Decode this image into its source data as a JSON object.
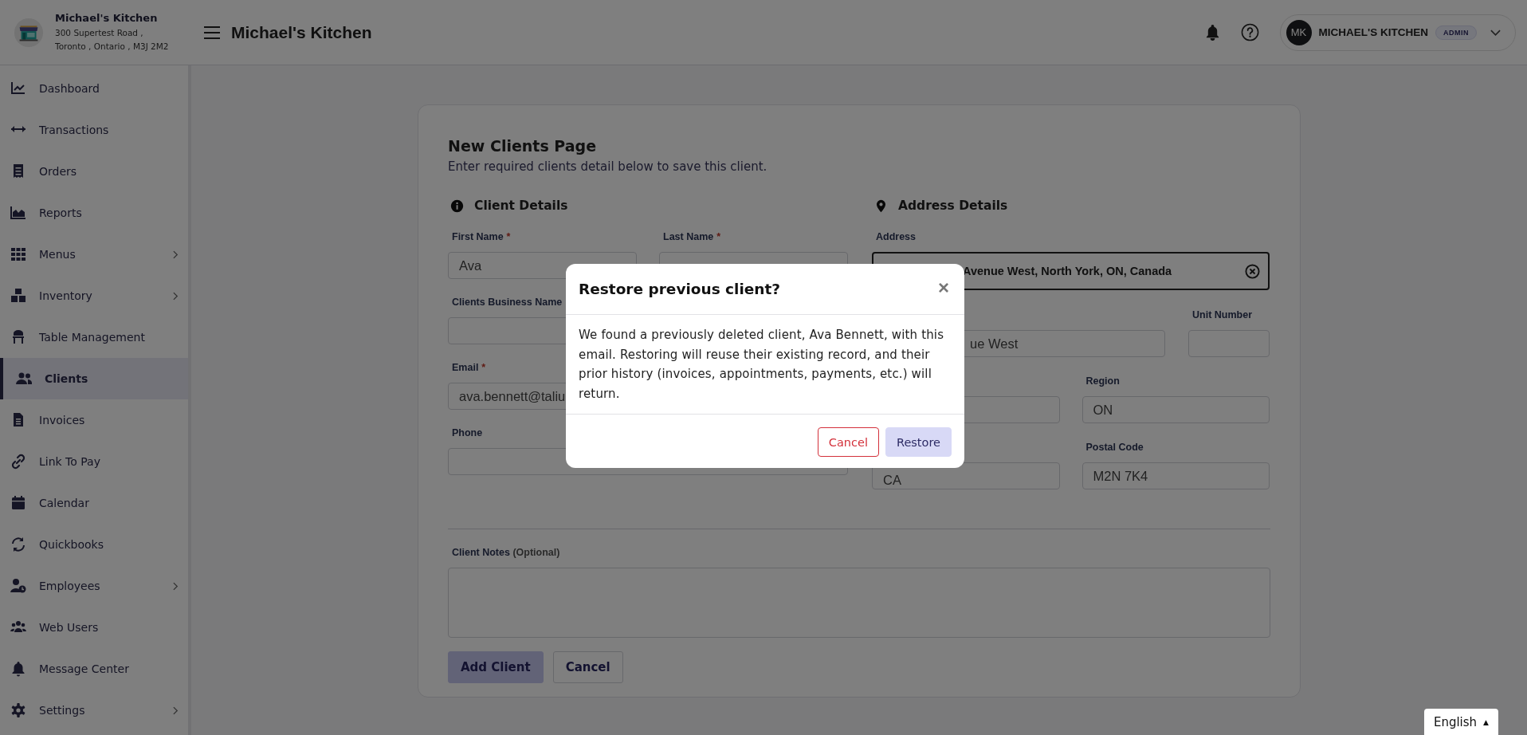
{
  "header": {
    "brand": {
      "name": "Michael's Kitchen",
      "address_lines": [
        "300 Supertest Road ,",
        "Toronto , Ontario , M3J 2M2"
      ]
    },
    "page_title": "Michael's Kitchen",
    "user": {
      "initials": "MK",
      "name": "MICHAEL'S KITCHEN",
      "role": "ADMIN"
    }
  },
  "sidebar": {
    "items": [
      {
        "label": "Dashboard",
        "selected": false,
        "has_submenu": false
      },
      {
        "label": "Transactions",
        "selected": false,
        "has_submenu": false
      },
      {
        "label": "Orders",
        "selected": false,
        "has_submenu": false
      },
      {
        "label": "Reports",
        "selected": false,
        "has_submenu": false
      },
      {
        "label": "Menus",
        "selected": false,
        "has_submenu": true
      },
      {
        "label": "Inventory",
        "selected": false,
        "has_submenu": true
      },
      {
        "label": "Table Management",
        "selected": false,
        "has_submenu": false
      },
      {
        "label": "Clients",
        "selected": true,
        "has_submenu": false
      },
      {
        "label": "Invoices",
        "selected": false,
        "has_submenu": false
      },
      {
        "label": "Link To Pay",
        "selected": false,
        "has_submenu": false
      },
      {
        "label": "Calendar",
        "selected": false,
        "has_submenu": false
      },
      {
        "label": "Quickbooks",
        "selected": false,
        "has_submenu": false
      },
      {
        "label": "Employees",
        "selected": false,
        "has_submenu": true
      },
      {
        "label": "Web Users",
        "selected": false,
        "has_submenu": false
      },
      {
        "label": "Message Center",
        "selected": false,
        "has_submenu": false
      },
      {
        "label": "Settings",
        "selected": false,
        "has_submenu": true
      }
    ]
  },
  "form": {
    "title": "New Clients Page",
    "subtitle": "Enter required clients detail below to save this client.",
    "client_details": {
      "heading": "Client Details",
      "rows": [
        [
          {
            "label": "First Name",
            "required_mark": "*",
            "value": "Ava"
          },
          {
            "label": "Last Name",
            "required_mark": "*"
          }
        ],
        [
          {
            "label": "Clients Business Name"
          }
        ],
        [
          {
            "label": "Email",
            "required_mark": "*",
            "value": "ava.bennett@taliu"
          }
        ],
        [
          {
            "label": "Phone"
          }
        ]
      ]
    },
    "address_details": {
      "heading": "Address Details",
      "rows": [
        [
          {
            "label": "Address",
            "kind": "search",
            "value": "Avenue West, North York, ON, Canada"
          }
        ],
        [
          {
            "kind": "partly-covered",
            "value": "ue West"
          },
          {
            "label": "Unit Number",
            "kind": "text"
          }
        ],
        [
          {
            "kind": "text"
          },
          {
            "label": "Region",
            "kind": "text",
            "value": "ON"
          }
        ],
        [
          {
            "kind": "text",
            "value": "CA"
          },
          {
            "label": "Postal Code",
            "kind": "text",
            "value": "M2N 7K4"
          }
        ]
      ]
    },
    "notes": {
      "label": "Client Notes",
      "hint": "(Optional)"
    },
    "buttons": [
      {
        "label": "Add Client",
        "kind": "primary"
      },
      {
        "label": "Cancel",
        "kind": "secondary"
      }
    ]
  },
  "dialog": {
    "title": "Restore previous client?",
    "close": "×",
    "message": "We found a previously deleted client, Ava Bennett, with this email. Restoring will reuse their existing record, and their prior history (invoices, appointments, payments, etc.) will return.",
    "buttons": [
      {
        "label": "Cancel",
        "kind": "danger"
      },
      {
        "label": "Restore",
        "kind": "primary"
      }
    ]
  },
  "language": {
    "label": "English",
    "caret": "▲"
  }
}
